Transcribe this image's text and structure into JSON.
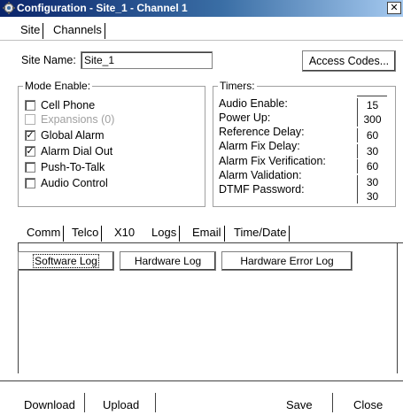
{
  "window": {
    "title": "Configuration - Site_1 - Channel  1",
    "close_glyph": "✕"
  },
  "top_tabs": [
    {
      "label": "Site"
    },
    {
      "label": "Channels"
    }
  ],
  "site": {
    "name_label": "Site Name:",
    "name_value": "Site_1",
    "access_codes_label": "Access Codes..."
  },
  "mode_enable": {
    "label": "Mode Enable:",
    "items": [
      {
        "label": "Cell Phone",
        "checked": false,
        "disabled": false
      },
      {
        "label": "Expansions (0)",
        "checked": false,
        "disabled": true
      },
      {
        "label": "Global Alarm",
        "checked": true,
        "disabled": false
      },
      {
        "label": "Alarm Dial Out",
        "checked": true,
        "disabled": false
      },
      {
        "label": "Push-To-Talk",
        "checked": false,
        "disabled": false
      },
      {
        "label": "Audio Control",
        "checked": false,
        "disabled": false
      }
    ]
  },
  "timers": {
    "label": "Timers:",
    "items": [
      {
        "label": "Audio Enable:",
        "value": "15"
      },
      {
        "label": "Power Up:",
        "value": "300"
      },
      {
        "label": "Reference Delay:",
        "value": "60"
      },
      {
        "label": "Alarm Fix Delay:",
        "value": "30"
      },
      {
        "label": "Alarm Fix Verification:",
        "value": "60"
      },
      {
        "label": "Alarm Validation:",
        "value": "30"
      },
      {
        "label": "DTMF Password:",
        "value": "30"
      }
    ]
  },
  "sub_tabs": [
    {
      "label": "Comm"
    },
    {
      "label": "Telco"
    },
    {
      "label": "X10"
    },
    {
      "label": "Logs"
    },
    {
      "label": "Email"
    },
    {
      "label": "Time/Date"
    }
  ],
  "logs": {
    "software_log": "Software Log",
    "hardware_log": "Hardware Log",
    "hardware_error_log": "Hardware Error Log"
  },
  "bottom": {
    "download": "Download",
    "upload": "Upload",
    "save": "Save",
    "close": "Close"
  },
  "colors": {
    "title_start": "#0a246a",
    "title_end": "#a6caf0",
    "disabled_text": "#a0a0a0"
  }
}
